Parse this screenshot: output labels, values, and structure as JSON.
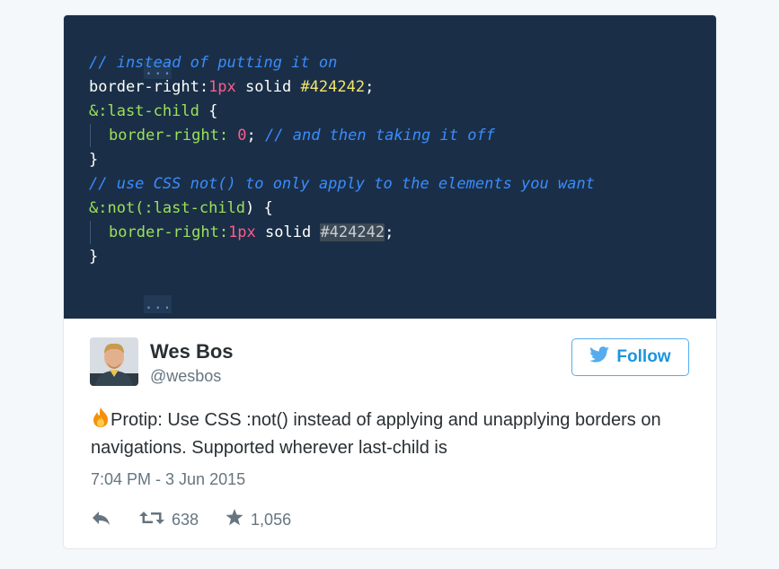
{
  "code": {
    "dots_top": "...",
    "comment1": "// instead of putting it on",
    "line2_prop": "border-right:",
    "line2_num": "1px",
    "line2_rest": " solid ",
    "line2_val": "#424242",
    "line2_end": ";",
    "line3_sel": "&:last-child",
    "line3_brace": " {",
    "line4_prop": "border-right: ",
    "line4_num": "0",
    "line4_semi": "; ",
    "line4_comment": "// and then taking it off",
    "close1": "}",
    "comment2": "// use CSS not() to only apply to the elements you want",
    "line7_sel_a": "&:not(",
    "line7_sel_b": ":last-child",
    "line7_sel_c": ")",
    "line7_brace": " {",
    "line8_prop": "border-right:",
    "line8_num": "1px",
    "line8_rest": " solid ",
    "line8_val": "#424242",
    "line8_end": ";",
    "close2": "}",
    "dots_bottom": "..."
  },
  "author": {
    "name": "Wes Bos",
    "handle": "@wesbos"
  },
  "follow_label": "Follow",
  "tweet_text": "Protip: Use CSS :not() instead of applying and unapplying borders on navigations. Supported wherever last-child is",
  "timestamp": "7:04 PM - 3 Jun 2015",
  "stats": {
    "retweets": "638",
    "likes": "1,056"
  },
  "icons": [
    "fire-icon",
    "twitter-bird-icon",
    "reply-icon",
    "retweet-icon",
    "star-icon"
  ],
  "colors": {
    "code_bg": "#1a2f47",
    "accent": "#55acee"
  }
}
